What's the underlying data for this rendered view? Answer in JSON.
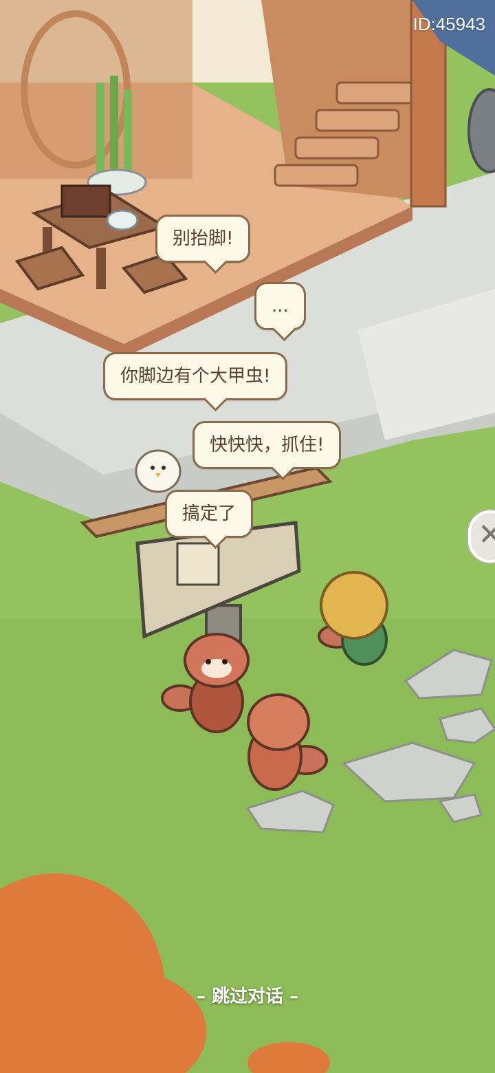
{
  "id_label": "ID:45943",
  "dialogue": [
    {
      "text": "别抬脚!"
    },
    {
      "text": "..."
    },
    {
      "text": "你脚边有个大甲虫!"
    },
    {
      "text": "快快快，抓住!"
    },
    {
      "text": "搞定了"
    }
  ],
  "skip_label": "– 跳过对话 –",
  "close_icon": "close-x-icon"
}
